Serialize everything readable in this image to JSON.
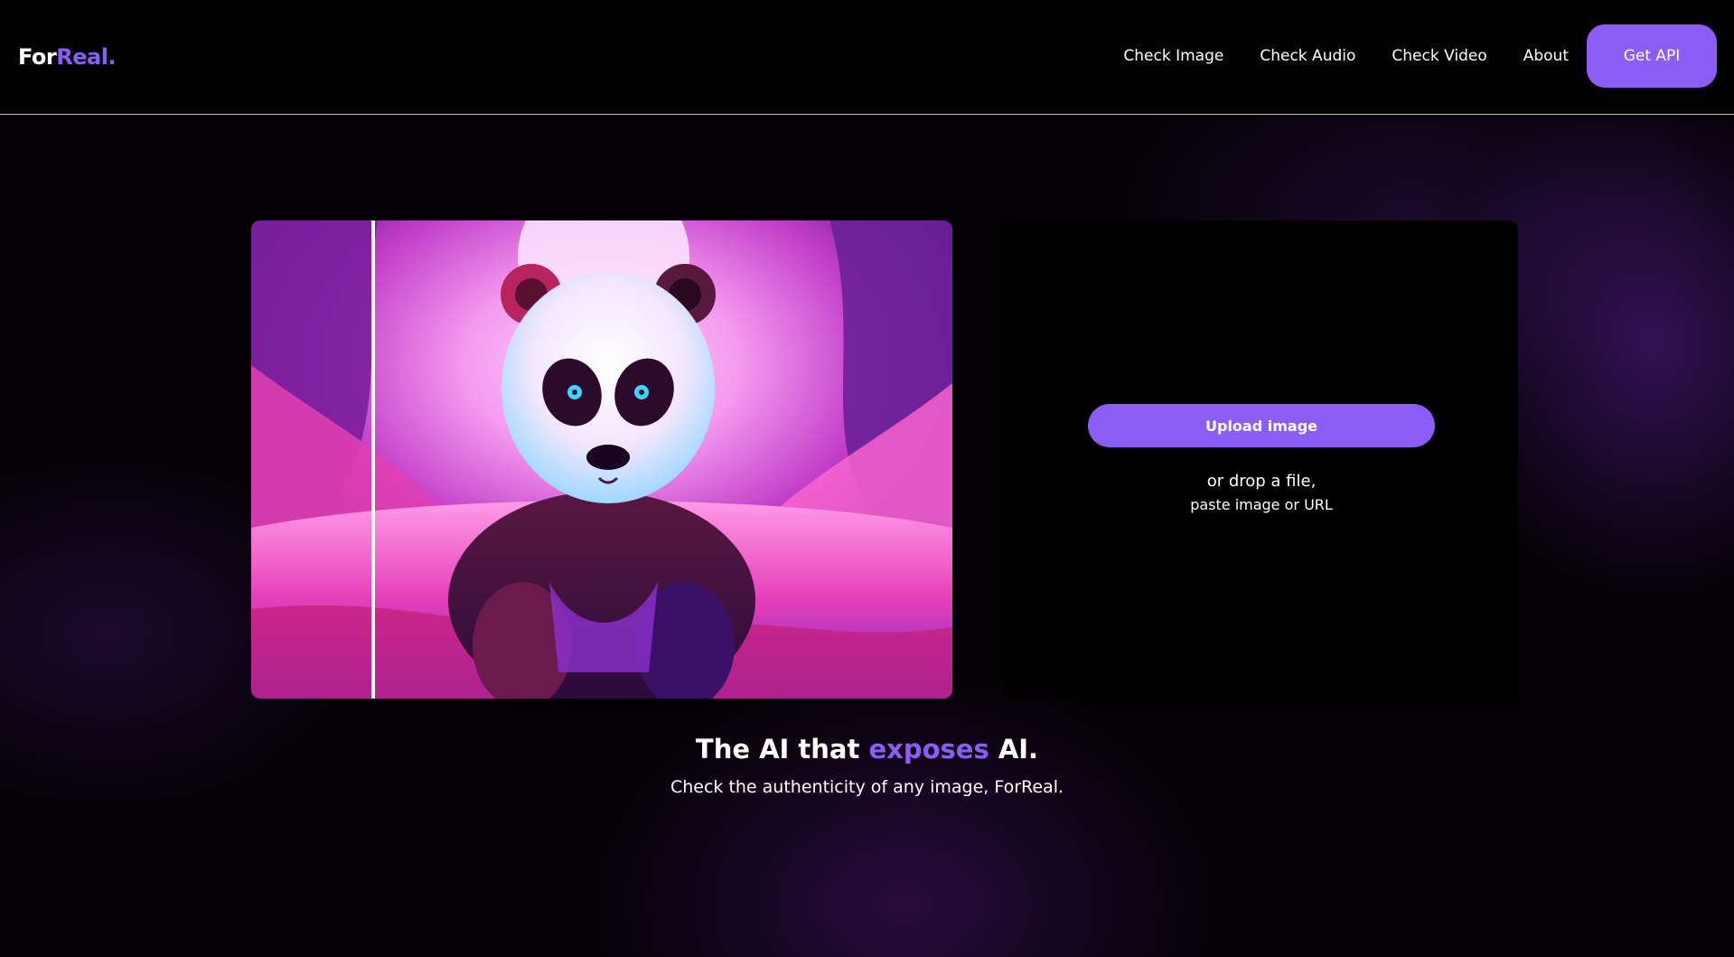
{
  "header": {
    "logo_part1": "For",
    "logo_part2": "Real.",
    "nav": {
      "check_image": "Check Image",
      "check_audio": "Check Audio",
      "check_video": "Check Video",
      "about": "About",
      "get_api": "Get API"
    }
  },
  "upload": {
    "button_label": "Upload image",
    "drop_line1": "or drop a file,",
    "drop_line2": "paste image or URL"
  },
  "hero": {
    "title_part1": "The AI that ",
    "title_accent": "exposes",
    "title_part2": " AI.",
    "subtitle": "Check the authenticity of any image, ForReal."
  },
  "colors": {
    "accent": "#8b5cf6",
    "background": "#030103",
    "panel": "#000000"
  },
  "demo_image": {
    "subject": "panda"
  }
}
